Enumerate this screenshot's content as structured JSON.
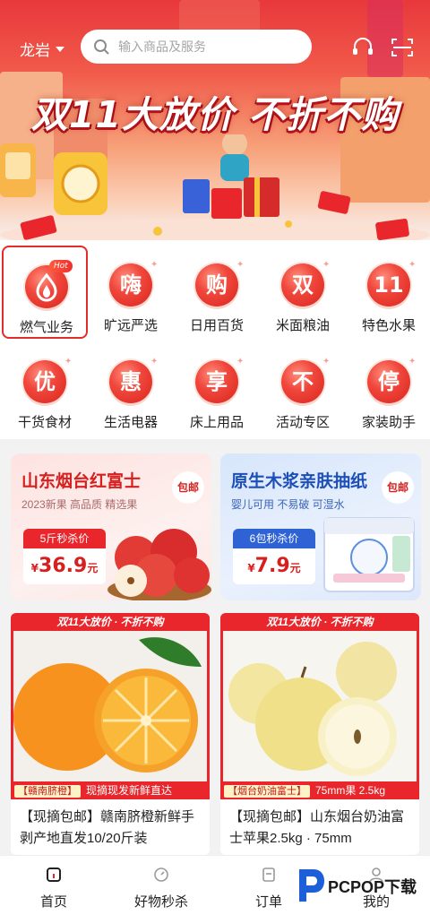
{
  "header": {
    "location": "龙岩",
    "search_placeholder": "输入商品及服务",
    "banner_title": "双11大放价 不折不购"
  },
  "categories": [
    {
      "label": "燃气业务",
      "glyph": "",
      "icon": "flame-icon",
      "hot": "Hot"
    },
    {
      "label": "旷远严选",
      "glyph": "嗨",
      "icon": "hi-icon"
    },
    {
      "label": "日用百货",
      "glyph": "购",
      "icon": "buy-icon"
    },
    {
      "label": "米面粮油",
      "glyph": "双",
      "icon": "double-icon"
    },
    {
      "label": "特色水果",
      "glyph": "11",
      "icon": "eleven-icon"
    },
    {
      "label": "干货食材",
      "glyph": "优",
      "icon": "excellent-icon"
    },
    {
      "label": "生活电器",
      "glyph": "惠",
      "icon": "discount-icon"
    },
    {
      "label": "床上用品",
      "glyph": "享",
      "icon": "enjoy-icon"
    },
    {
      "label": "活动专区",
      "glyph": "不",
      "icon": "no-icon"
    },
    {
      "label": "家装助手",
      "glyph": "停",
      "icon": "stop-icon"
    }
  ],
  "promos": [
    {
      "title": "山东烟台红富士",
      "subtitle": "2023新果 高品质 精选果",
      "tag": "包邮",
      "deal": "5斤秒杀价",
      "currency": "¥",
      "price": "36.9",
      "unit": "元"
    },
    {
      "title": "原生木浆亲肤抽纸",
      "subtitle": "婴儿可用 不易破 可湿水",
      "tag": "包邮",
      "deal": "6包秒杀价",
      "currency": "¥",
      "price": "7.9",
      "unit": "元"
    }
  ],
  "products": [
    {
      "ribbon": "双11大放价 · 不折不购",
      "badge": "【赣南脐橙】",
      "strip": "现摘现发新鲜直达",
      "name": "【现摘包邮】赣南脐橙新鲜手剥产地直发10/20斤装"
    },
    {
      "ribbon": "双11大放价 · 不折不购",
      "badge": "【烟台奶油富士】",
      "strip": "75mm果 2.5kg",
      "name": "【现摘包邮】山东烟台奶油富士苹果2.5kg · 75mm"
    }
  ],
  "tabbar": [
    {
      "label": "首页",
      "icon": "home-icon"
    },
    {
      "label": "好物秒杀",
      "icon": "flash-sale-icon"
    },
    {
      "label": "订单",
      "icon": "order-icon"
    },
    {
      "label": "我的",
      "icon": "profile-icon"
    }
  ],
  "watermark": "PCPOP下载",
  "colors": {
    "brand_red": "#e8262b",
    "promo_pink": "#fdeceb",
    "promo_blue": "#dde9fb"
  }
}
